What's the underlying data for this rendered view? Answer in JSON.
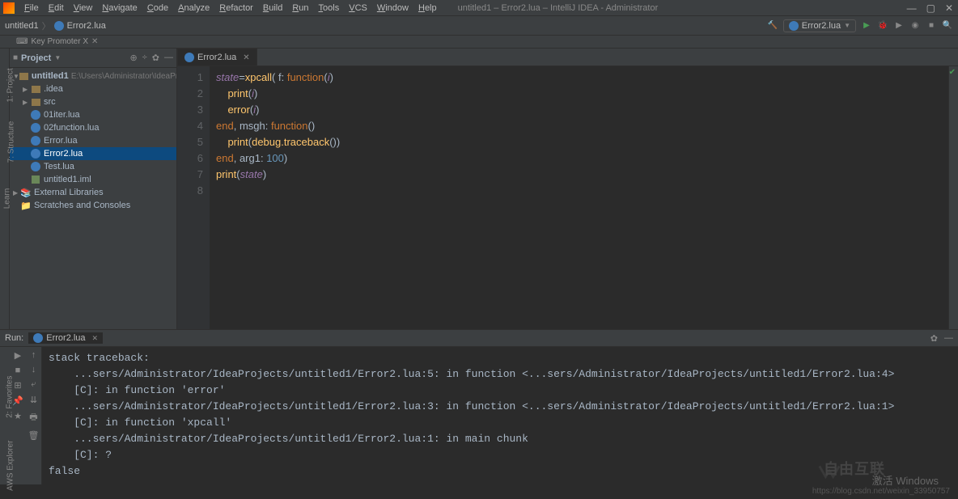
{
  "window": {
    "title": "untitled1 – Error2.lua – IntelliJ IDEA - Administrator"
  },
  "menu": [
    "File",
    "Edit",
    "View",
    "Navigate",
    "Code",
    "Analyze",
    "Refactor",
    "Build",
    "Run",
    "Tools",
    "VCS",
    "Window",
    "Help"
  ],
  "keypromoter": "Key Promoter X",
  "nav": {
    "crumb1": "untitled1",
    "crumb2": "Error2.lua"
  },
  "runconfig": "Error2.lua",
  "project": {
    "title": "Project",
    "root": "untitled1",
    "rootPath": "E:\\Users\\Administrator\\IdeaProjects\\unt",
    "items": [
      {
        "name": ".idea",
        "type": "folder"
      },
      {
        "name": "src",
        "type": "folder"
      },
      {
        "name": "01iter.lua",
        "type": "lua"
      },
      {
        "name": "02function.lua",
        "type": "lua"
      },
      {
        "name": "Error.lua",
        "type": "lua"
      },
      {
        "name": "Error2.lua",
        "type": "lua",
        "selected": true
      },
      {
        "name": "Test.lua",
        "type": "lua"
      },
      {
        "name": "untitled1.iml",
        "type": "iml"
      }
    ],
    "ext1": "External Libraries",
    "ext2": "Scratches and Consoles"
  },
  "tabs": [
    {
      "label": "Error2.lua",
      "active": true
    }
  ],
  "code": {
    "lines": [
      {
        "n": 1,
        "html": "<span class='id'>state</span><span class='pn'>=</span><span class='fn'>xpcall</span><span class='pn'>( </span><span class='pn'>f: </span><span class='kw'>function</span><span class='pn'>(</span><span class='id'>i</span><span class='pn'>)</span>"
      },
      {
        "n": 2,
        "html": "    <span class='fn'>print</span><span class='pn'>(</span><span class='id'>i</span><span class='pn'>)</span>"
      },
      {
        "n": 3,
        "html": "    <span class='fn'>error</span><span class='pn'>(</span><span class='id'>i</span><span class='pn'>)</span>"
      },
      {
        "n": 4,
        "html": "<span class='kw'>end</span><span class='pn'>, </span><span class='pn'>msgh: </span><span class='kw'>function</span><span class='pn'>()</span>"
      },
      {
        "n": 5,
        "html": "    <span class='fn'>print</span><span class='pn'>(</span><span class='fn'>debug.traceback</span><span class='pn'>())</span>"
      },
      {
        "n": 6,
        "html": "<span class='kw'>end</span><span class='pn'>, </span><span class='pn'>arg1: </span><span class='num'>100</span><span class='pn'>)</span>"
      },
      {
        "n": 7,
        "html": "<span class='fn'>print</span><span class='pn'>(</span><span class='id'>state</span><span class='pn'>)</span>"
      },
      {
        "n": 8,
        "html": "",
        "current": true
      }
    ]
  },
  "run": {
    "label": "Run:",
    "tab": "Error2.lua",
    "output": [
      "stack traceback:",
      "    ...sers/Administrator/IdeaProjects/untitled1/Error2.lua:5: in function <...sers/Administrator/IdeaProjects/untitled1/Error2.lua:4>",
      "    [C]: in function 'error'",
      "    ...sers/Administrator/IdeaProjects/untitled1/Error2.lua:3: in function <...sers/Administrator/IdeaProjects/untitled1/Error2.lua:1>",
      "    [C]: in function 'xpcall'",
      "    ...sers/Administrator/IdeaProjects/untitled1/Error2.lua:1: in main chunk",
      "    [C]: ?",
      "false"
    ]
  },
  "sidetabs": {
    "project": "1: Project",
    "structure": "7: Structure",
    "learn": "Learn",
    "fav": "2: Favorites",
    "aws": "AWS Explorer"
  },
  "watermark": {
    "activate": "激活 Windows",
    "blog": "https://blog.csdn.net/weixin_33950757",
    "brand": "自由互联"
  }
}
